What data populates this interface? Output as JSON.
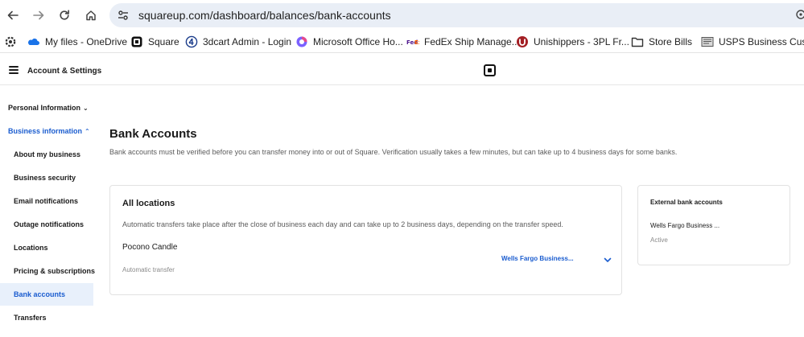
{
  "browser": {
    "url": "squareup.com/dashboard/balances/bank-accounts",
    "bookmarks": [
      {
        "label": "My files - OneDrive",
        "icon": "onedrive-icon"
      },
      {
        "label": "Square",
        "icon": "square-icon"
      },
      {
        "label": "3dcart Admin - Login",
        "icon": "3dcart-icon"
      },
      {
        "label": "Microsoft Office Ho...",
        "icon": "office-icon"
      },
      {
        "label": "FedEx Ship Manage...",
        "icon": "fedex-icon"
      },
      {
        "label": "Unishippers - 3PL Fr...",
        "icon": "unishippers-icon"
      },
      {
        "label": "Store Bills",
        "icon": "folder-icon"
      },
      {
        "label": "USPS Business Cust...",
        "icon": "usps-icon"
      }
    ]
  },
  "header": {
    "title": "Account & Settings"
  },
  "sidebar": {
    "groups": [
      {
        "label": "Personal Information",
        "expanded": false
      },
      {
        "label": "Business information",
        "expanded": true
      }
    ],
    "items": [
      {
        "label": "About my business"
      },
      {
        "label": "Business security"
      },
      {
        "label": "Email notifications"
      },
      {
        "label": "Outage notifications"
      },
      {
        "label": "Locations"
      },
      {
        "label": "Pricing & subscriptions"
      },
      {
        "label": "Bank accounts",
        "active": true
      },
      {
        "label": "Transfers"
      }
    ]
  },
  "main": {
    "title": "Bank Accounts",
    "description": "Bank accounts must be verified before you can transfer money into or out of Square. Verification usually takes a few minutes, but can take up to 4 business days for some banks.",
    "locations_card": {
      "title": "All locations",
      "description": "Automatic transfers take place after the close of business each day and can take up to 2 business days, depending on the transfer speed.",
      "location_name": "Pocono Candle",
      "transfer_type": "Automatic transfer",
      "selected_bank": "Wells Fargo Business..."
    },
    "external_card": {
      "title": "External bank accounts",
      "bank_name": "Wells Fargo Business ...",
      "status": "Active"
    }
  },
  "colors": {
    "accent": "#1a5ccf",
    "active_bg": "#e8f0fb",
    "url_bar": "#e9eef6"
  }
}
